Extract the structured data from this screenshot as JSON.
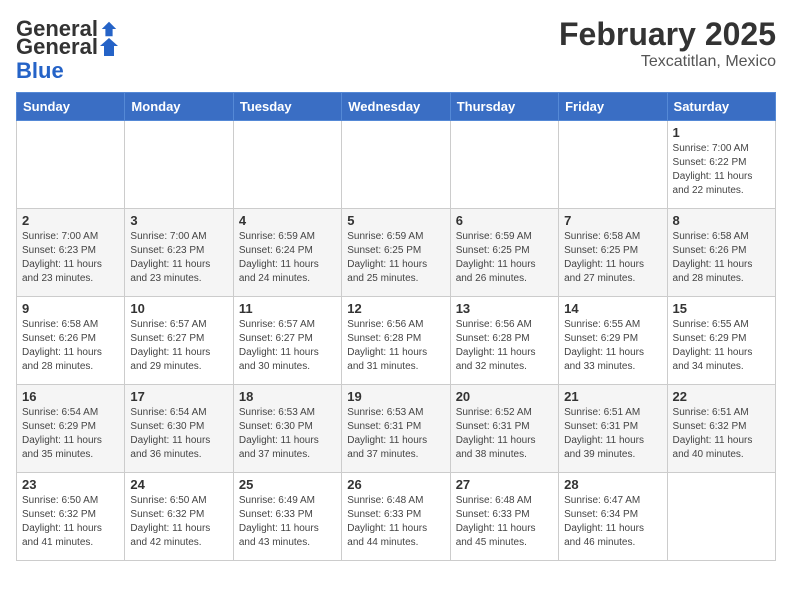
{
  "logo": {
    "general": "General",
    "blue": "Blue"
  },
  "title": "February 2025",
  "location": "Texcatitlan, Mexico",
  "days_of_week": [
    "Sunday",
    "Monday",
    "Tuesday",
    "Wednesday",
    "Thursday",
    "Friday",
    "Saturday"
  ],
  "weeks": [
    [
      {
        "day": "",
        "info": ""
      },
      {
        "day": "",
        "info": ""
      },
      {
        "day": "",
        "info": ""
      },
      {
        "day": "",
        "info": ""
      },
      {
        "day": "",
        "info": ""
      },
      {
        "day": "",
        "info": ""
      },
      {
        "day": "1",
        "info": "Sunrise: 7:00 AM\nSunset: 6:22 PM\nDaylight: 11 hours and 22 minutes."
      }
    ],
    [
      {
        "day": "2",
        "info": "Sunrise: 7:00 AM\nSunset: 6:23 PM\nDaylight: 11 hours and 23 minutes."
      },
      {
        "day": "3",
        "info": "Sunrise: 7:00 AM\nSunset: 6:23 PM\nDaylight: 11 hours and 23 minutes."
      },
      {
        "day": "4",
        "info": "Sunrise: 6:59 AM\nSunset: 6:24 PM\nDaylight: 11 hours and 24 minutes."
      },
      {
        "day": "5",
        "info": "Sunrise: 6:59 AM\nSunset: 6:25 PM\nDaylight: 11 hours and 25 minutes."
      },
      {
        "day": "6",
        "info": "Sunrise: 6:59 AM\nSunset: 6:25 PM\nDaylight: 11 hours and 26 minutes."
      },
      {
        "day": "7",
        "info": "Sunrise: 6:58 AM\nSunset: 6:25 PM\nDaylight: 11 hours and 27 minutes."
      },
      {
        "day": "8",
        "info": "Sunrise: 6:58 AM\nSunset: 6:26 PM\nDaylight: 11 hours and 28 minutes."
      }
    ],
    [
      {
        "day": "9",
        "info": "Sunrise: 6:58 AM\nSunset: 6:26 PM\nDaylight: 11 hours and 28 minutes."
      },
      {
        "day": "10",
        "info": "Sunrise: 6:57 AM\nSunset: 6:27 PM\nDaylight: 11 hours and 29 minutes."
      },
      {
        "day": "11",
        "info": "Sunrise: 6:57 AM\nSunset: 6:27 PM\nDaylight: 11 hours and 30 minutes."
      },
      {
        "day": "12",
        "info": "Sunrise: 6:56 AM\nSunset: 6:28 PM\nDaylight: 11 hours and 31 minutes."
      },
      {
        "day": "13",
        "info": "Sunrise: 6:56 AM\nSunset: 6:28 PM\nDaylight: 11 hours and 32 minutes."
      },
      {
        "day": "14",
        "info": "Sunrise: 6:55 AM\nSunset: 6:29 PM\nDaylight: 11 hours and 33 minutes."
      },
      {
        "day": "15",
        "info": "Sunrise: 6:55 AM\nSunset: 6:29 PM\nDaylight: 11 hours and 34 minutes."
      }
    ],
    [
      {
        "day": "16",
        "info": "Sunrise: 6:54 AM\nSunset: 6:29 PM\nDaylight: 11 hours and 35 minutes."
      },
      {
        "day": "17",
        "info": "Sunrise: 6:54 AM\nSunset: 6:30 PM\nDaylight: 11 hours and 36 minutes."
      },
      {
        "day": "18",
        "info": "Sunrise: 6:53 AM\nSunset: 6:30 PM\nDaylight: 11 hours and 37 minutes."
      },
      {
        "day": "19",
        "info": "Sunrise: 6:53 AM\nSunset: 6:31 PM\nDaylight: 11 hours and 37 minutes."
      },
      {
        "day": "20",
        "info": "Sunrise: 6:52 AM\nSunset: 6:31 PM\nDaylight: 11 hours and 38 minutes."
      },
      {
        "day": "21",
        "info": "Sunrise: 6:51 AM\nSunset: 6:31 PM\nDaylight: 11 hours and 39 minutes."
      },
      {
        "day": "22",
        "info": "Sunrise: 6:51 AM\nSunset: 6:32 PM\nDaylight: 11 hours and 40 minutes."
      }
    ],
    [
      {
        "day": "23",
        "info": "Sunrise: 6:50 AM\nSunset: 6:32 PM\nDaylight: 11 hours and 41 minutes."
      },
      {
        "day": "24",
        "info": "Sunrise: 6:50 AM\nSunset: 6:32 PM\nDaylight: 11 hours and 42 minutes."
      },
      {
        "day": "25",
        "info": "Sunrise: 6:49 AM\nSunset: 6:33 PM\nDaylight: 11 hours and 43 minutes."
      },
      {
        "day": "26",
        "info": "Sunrise: 6:48 AM\nSunset: 6:33 PM\nDaylight: 11 hours and 44 minutes."
      },
      {
        "day": "27",
        "info": "Sunrise: 6:48 AM\nSunset: 6:33 PM\nDaylight: 11 hours and 45 minutes."
      },
      {
        "day": "28",
        "info": "Sunrise: 6:47 AM\nSunset: 6:34 PM\nDaylight: 11 hours and 46 minutes."
      },
      {
        "day": "",
        "info": ""
      }
    ]
  ]
}
